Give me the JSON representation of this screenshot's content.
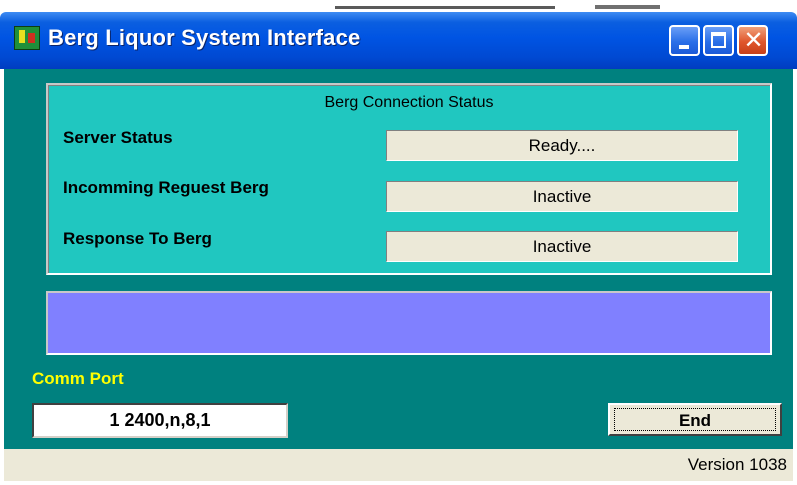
{
  "window": {
    "title": "Berg Liquor System Interface",
    "controls": {
      "minimize": "minimize",
      "maximize": "maximize",
      "close": "close"
    },
    "colors": {
      "titlebar": "#0054e3",
      "client": "#00817f",
      "status_frame": "#20c7c0",
      "message_panel": "#8080ff"
    }
  },
  "status_frame": {
    "title": "Berg Connection Status",
    "rows": [
      {
        "label": "Server Status",
        "value": "Ready...."
      },
      {
        "label": "Incomming Reguest Berg",
        "value": "Inactive"
      },
      {
        "label": "Response To Berg",
        "value": "Inactive"
      }
    ]
  },
  "message_panel": {
    "text": ""
  },
  "comm_port": {
    "label": "Comm Port",
    "value": "1 2400,n,8,1",
    "label_color": "#ffff00"
  },
  "buttons": {
    "end_label": "End"
  },
  "statusbar": {
    "version": "Version 1038"
  }
}
